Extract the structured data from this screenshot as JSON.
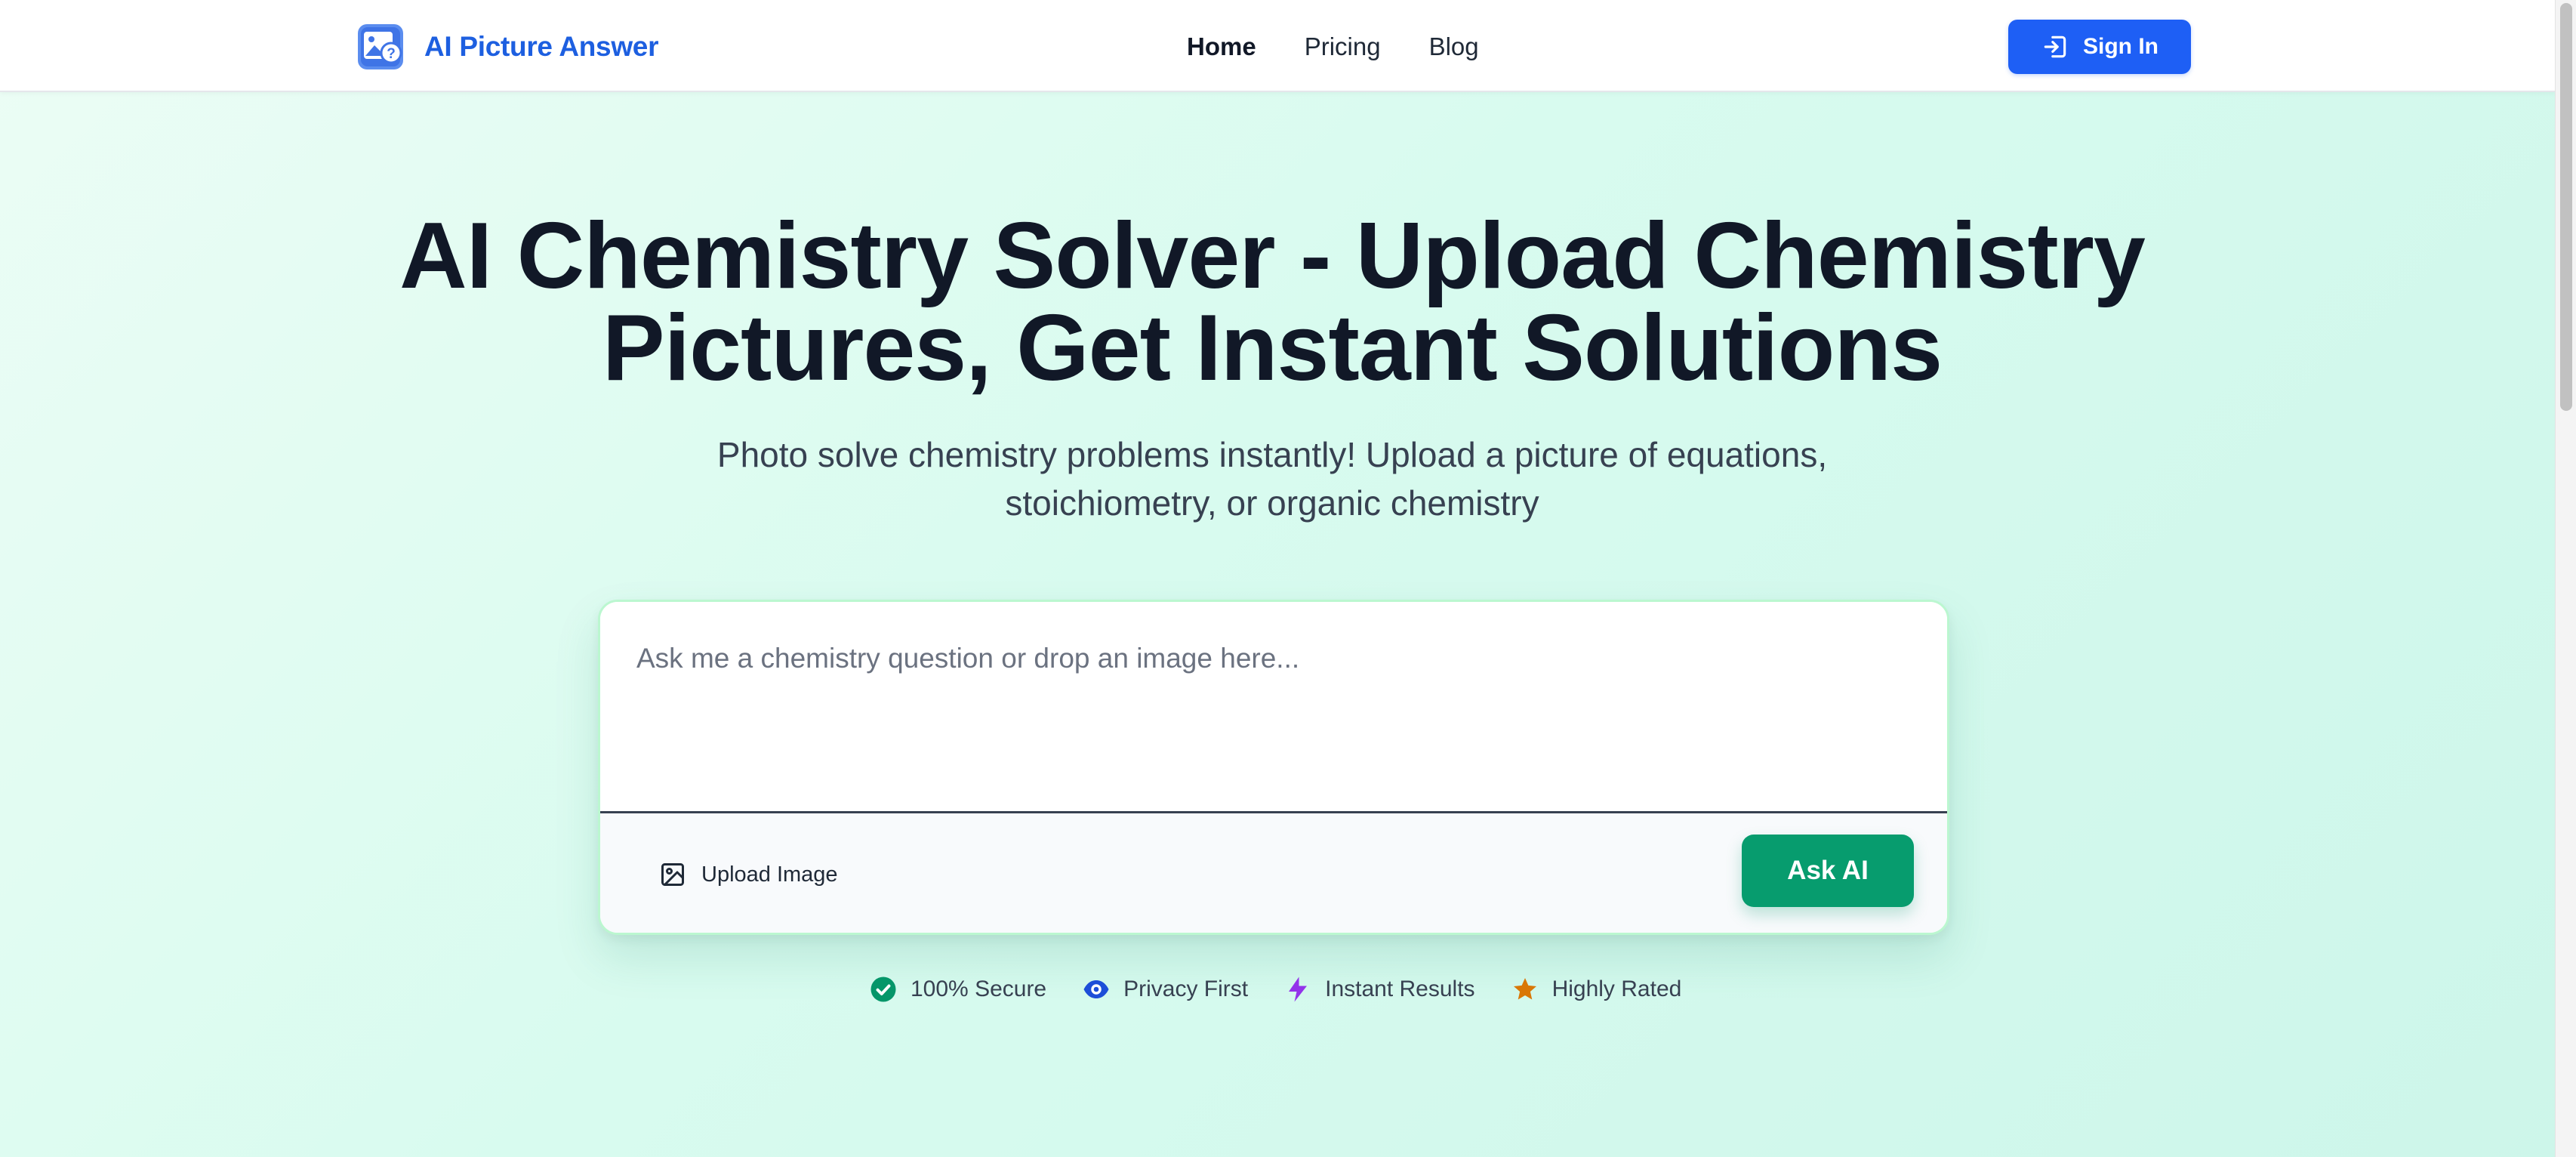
{
  "header": {
    "brand_name": "AI Picture Answer",
    "nav": [
      {
        "label": "Home",
        "active": true
      },
      {
        "label": "Pricing",
        "active": false
      },
      {
        "label": "Blog",
        "active": false
      }
    ],
    "signin_label": "Sign In",
    "signin_icon": "sign-in-icon"
  },
  "hero": {
    "title_line1": "AI Chemistry Solver - Upload Chemistry",
    "title_line2": "Pictures, Get Instant Solutions",
    "subtitle_line1": "Photo solve chemistry problems instantly! Upload a picture of equations,",
    "subtitle_line2": "stoichiometry, or organic chemistry"
  },
  "question_box": {
    "placeholder": "Ask me a chemistry question or drop an image here...",
    "value": "",
    "upload_label": "Upload Image",
    "upload_icon": "image-icon",
    "ask_label": "Ask AI"
  },
  "badges": [
    {
      "label": "100% Secure",
      "icon": "check-circle-icon",
      "color": "#059669"
    },
    {
      "label": "Privacy First",
      "icon": "eye-icon",
      "color": "#1d4ed8"
    },
    {
      "label": "Instant Results",
      "icon": "lightning-icon",
      "color": "#9333ea"
    },
    {
      "label": "Highly Rated",
      "icon": "star-icon",
      "color": "#d97706"
    }
  ],
  "colors": {
    "brand": "#1d5fe0",
    "primary_button": "#1e5ff5",
    "ask_button": "#079c6e",
    "card_border": "#bbf7d0"
  }
}
